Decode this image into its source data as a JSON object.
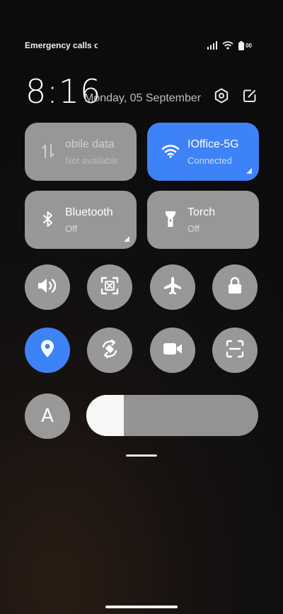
{
  "status_bar": {
    "carrier_text": "Emergency calls o",
    "battery_label": "00",
    "icons": [
      "signal-icon",
      "wifi-icon",
      "battery-icon"
    ]
  },
  "header": {
    "time": "8:16",
    "date": "Monday, 05 September",
    "icons": [
      "settings-icon",
      "edit-icon"
    ]
  },
  "tiles": [
    {
      "id": "mobile-data",
      "title": "obile data",
      "subtitle": "Not available",
      "active": false,
      "icon": "mobile-data-icon"
    },
    {
      "id": "wifi",
      "title": "IOffice-5G",
      "subtitle": "Connected",
      "active": true,
      "icon": "wifi-icon"
    },
    {
      "id": "bluetooth",
      "title": "Bluetooth",
      "subtitle": "Off",
      "active": false,
      "icon": "bluetooth-icon"
    },
    {
      "id": "torch",
      "title": "Torch",
      "subtitle": "Off",
      "active": false,
      "icon": "torch-icon"
    }
  ],
  "toggles": [
    {
      "id": "sound",
      "icon": "speaker-icon",
      "active": false
    },
    {
      "id": "screenshot",
      "icon": "screenshot-icon",
      "active": false
    },
    {
      "id": "airplane",
      "icon": "airplane-icon",
      "active": false
    },
    {
      "id": "lock-rotation",
      "icon": "lock-icon",
      "active": false
    },
    {
      "id": "location",
      "icon": "location-icon",
      "active": true
    },
    {
      "id": "auto-rotate",
      "icon": "rotate-icon",
      "active": false
    },
    {
      "id": "screen-record",
      "icon": "video-camera-icon",
      "active": false
    },
    {
      "id": "scanner",
      "icon": "scan-icon",
      "active": false
    }
  ],
  "auto_brightness": {
    "label": "A",
    "active": false
  },
  "brightness": {
    "level": 0.22
  },
  "colors": {
    "accent": "#3e82f7",
    "tile": "#cdcdcd"
  }
}
